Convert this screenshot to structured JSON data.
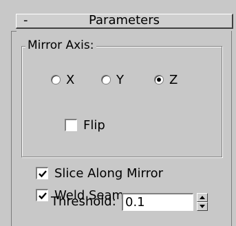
{
  "rollout": {
    "toggle": "-",
    "title": "Parameters"
  },
  "mirror_axis": {
    "title": "Mirror Axis:",
    "options": [
      {
        "label": "X",
        "selected": false
      },
      {
        "label": "Y",
        "selected": false
      },
      {
        "label": "Z",
        "selected": true
      }
    ],
    "flip": {
      "label": "Flip",
      "checked": false
    }
  },
  "options": {
    "slice_along_mirror": {
      "label": "Slice Along Mirror",
      "checked": true
    },
    "weld_seam": {
      "label": "Weld Seam",
      "checked": true
    }
  },
  "threshold": {
    "label": "Threshold:",
    "value": "0.1"
  },
  "colors": {
    "panel_bg": "#c8c8c8",
    "shadow": "#808080",
    "highlight": "#ffffff"
  }
}
